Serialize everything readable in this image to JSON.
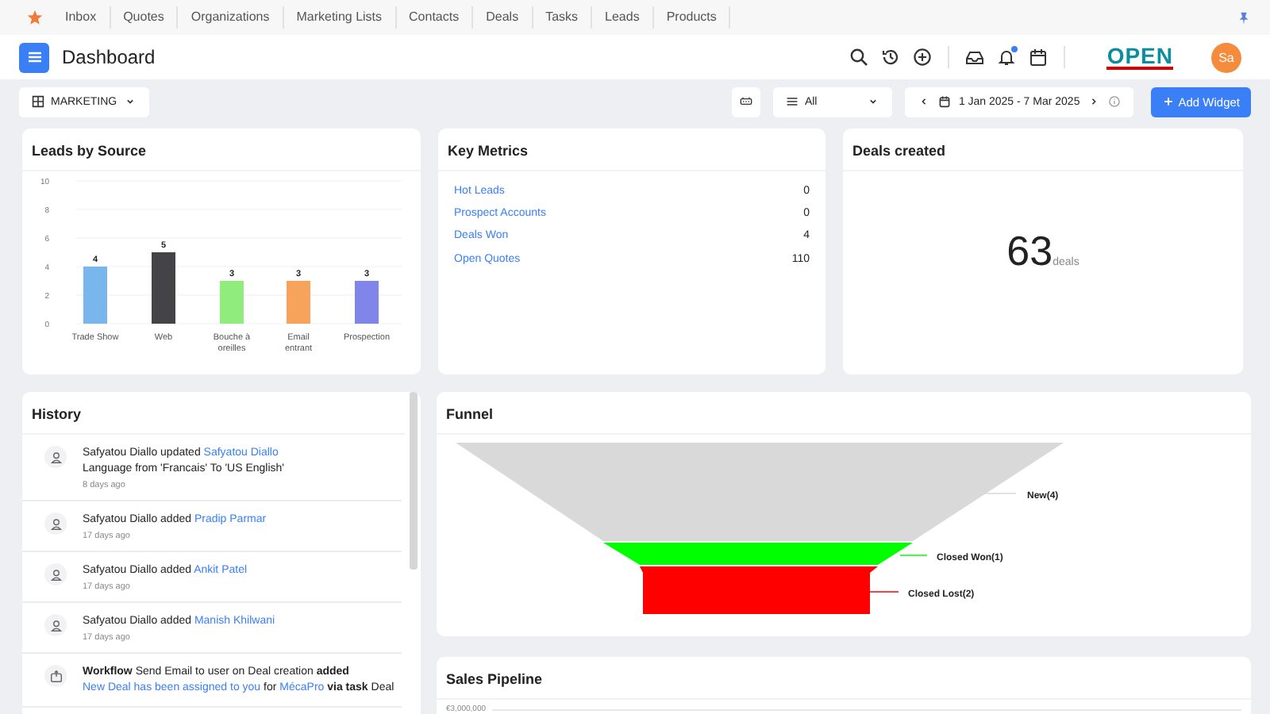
{
  "top_nav": {
    "items": [
      "Inbox",
      "Quotes",
      "Organizations",
      "Marketing Lists",
      "Contacts",
      "Deals",
      "Tasks",
      "Leads",
      "Products"
    ]
  },
  "header": {
    "title": "Dashboard",
    "logo_text": "OPEN",
    "avatar_initials": "Sa",
    "notification_dot": true
  },
  "toolbar": {
    "dashboard_select": "MARKETING",
    "filter_select": "All",
    "date_range": "1 Jan 2025 - 7 Mar 2025",
    "add_button": "Add Widget"
  },
  "leads_by_source": {
    "title": "Leads by Source",
    "chart_data": {
      "type": "bar",
      "categories": [
        "Trade Show",
        "Web",
        "Bouche à oreilles",
        "Email entrant",
        "Prospection"
      ],
      "values": [
        4,
        5,
        3,
        3,
        3
      ],
      "grid": true,
      "colors": [
        "#7ab6ee",
        "#434348",
        "#90ed7d",
        "#f7a35c",
        "#8085e9"
      ],
      "ylim": [
        0,
        10
      ],
      "yticks": [
        0,
        2,
        4,
        6,
        8,
        10
      ],
      "data_labels": true
    }
  },
  "key_metrics": {
    "title": "Key Metrics",
    "rows": [
      {
        "label": "Hot Leads",
        "value": "0"
      },
      {
        "label": "Prospect Accounts",
        "value": "0"
      },
      {
        "label": "Deals Won",
        "value": "4"
      },
      {
        "label": "Open Quotes",
        "value": "110"
      }
    ]
  },
  "deals_created": {
    "title": "Deals created",
    "value": "63",
    "unit": "deals"
  },
  "history": {
    "title": "History",
    "items": [
      {
        "kind": "user",
        "parts": [
          {
            "kind": "text",
            "text": "Safyatou Diallo updated"
          },
          {
            "kind": "link",
            "text": "Safyatou Diallo"
          },
          {
            "kind": "text",
            "text": "Language from 'Francais' To 'US English'"
          }
        ],
        "time": "8 days ago"
      },
      {
        "kind": "user",
        "parts": [
          {
            "kind": "text",
            "text": "Safyatou Diallo added"
          },
          {
            "kind": "link",
            "text": "Pradip Parmar"
          }
        ],
        "time": "17 days ago"
      },
      {
        "kind": "user",
        "parts": [
          {
            "kind": "text",
            "text": "Safyatou Diallo added"
          },
          {
            "kind": "link",
            "text": "Ankit Patel"
          }
        ],
        "time": "17 days ago"
      },
      {
        "kind": "user",
        "parts": [
          {
            "kind": "text",
            "text": "Safyatou Diallo added"
          },
          {
            "kind": "link",
            "text": "Manish Khilwani"
          }
        ],
        "time": "17 days ago"
      },
      {
        "kind": "workflow",
        "parts": [
          {
            "kind": "text",
            "text": "**Workflow** Send Email to user on Deal creation **added**"
          },
          {
            "kind": "link",
            "text": "New Deal has been assigned to you"
          },
          {
            "kind": "text",
            "text": "for"
          },
          {
            "kind": "link",
            "text": "MécaPro"
          },
          {
            "kind": "text",
            "text": "**via task** Deal"
          }
        ]
      }
    ]
  },
  "funnel": {
    "title": "Funnel",
    "stages": [
      {
        "label": "New(4)",
        "color": "#d9d9d9"
      },
      {
        "label": "Closed Won(1)",
        "color": "#00ff00"
      },
      {
        "label": "Closed Lost(2)",
        "color": "#ff0000"
      }
    ]
  },
  "sales_pipeline": {
    "title": "Sales Pipeline",
    "axis_label": "€3,000,000"
  }
}
